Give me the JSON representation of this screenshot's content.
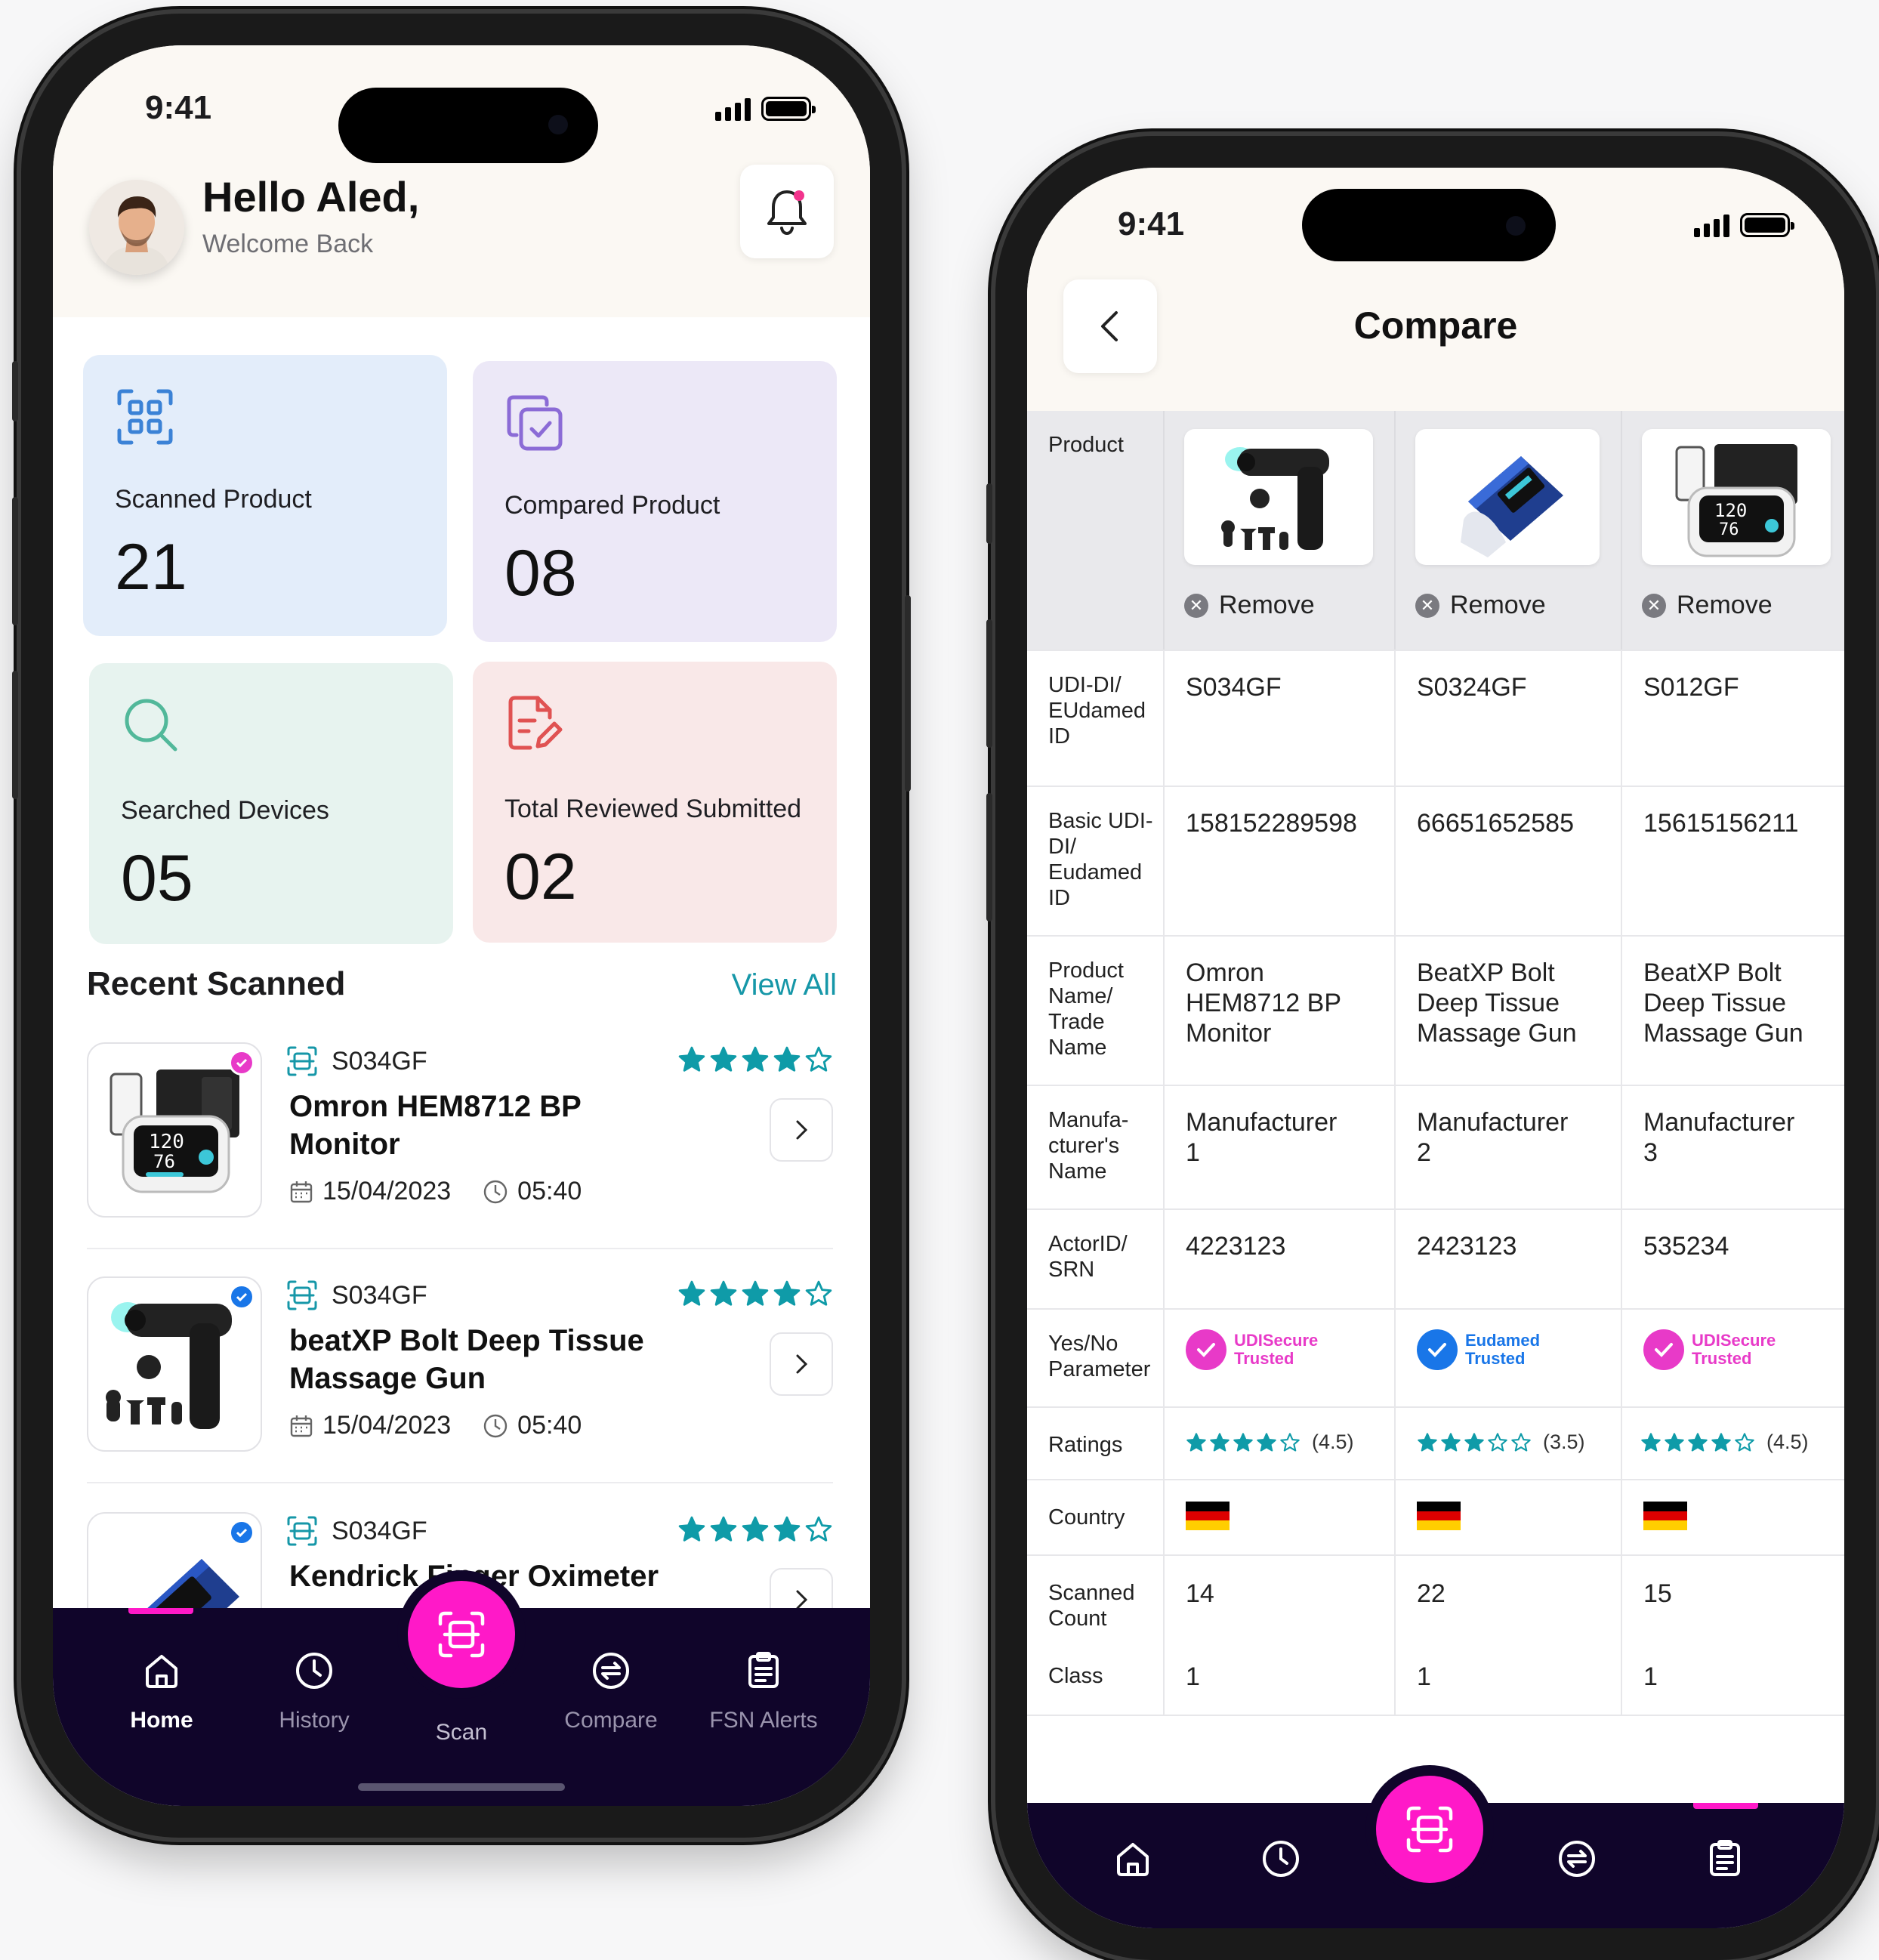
{
  "colors": {
    "accent": "#1697a8",
    "scan_button": "#ff19c8",
    "tab_bar": "#10052a",
    "star": "#0f9ba8",
    "card_scanned": "#e3edfa",
    "card_compared": "#ece8f7",
    "card_searched": "#e7f3ef",
    "card_reviewed": "#f9e8e8"
  },
  "home": {
    "status_time": "9:41",
    "greeting": "Hello Aled,",
    "subtitle": "Welcome Back",
    "stats": [
      {
        "label": "Scanned Product",
        "value": "21",
        "icon": "scan-grid-icon"
      },
      {
        "label": "Compared Product",
        "value": "08",
        "icon": "compare-copy-icon"
      },
      {
        "label": "Searched Devices",
        "value": "05",
        "icon": "search-icon"
      },
      {
        "label": "Total Reviewed Submitted",
        "value": "02",
        "icon": "review-document-icon"
      }
    ],
    "recent_title": "Recent Scanned",
    "view_all": "View All",
    "recent": [
      {
        "code": "S034GF",
        "name": "Omron HEM8712 BP Monitor",
        "date": "15/04/2023",
        "time": "05:40",
        "rating": 4,
        "badge": "udisecure"
      },
      {
        "code": "S034GF",
        "name": "beatXP Bolt Deep Tissue Massage Gun",
        "date": "15/04/2023",
        "time": "05:40",
        "rating": 4,
        "badge": "eudamed"
      },
      {
        "code": "S034GF",
        "name": "Kendrick Finger Oximeter",
        "date": "",
        "time": "",
        "rating": 4,
        "badge": "eudamed"
      }
    ],
    "tabs": [
      {
        "label": "Home",
        "icon": "home-icon"
      },
      {
        "label": "History",
        "icon": "clock-icon"
      },
      {
        "label": "Scan",
        "icon": "scan-icon"
      },
      {
        "label": "Compare",
        "icon": "compare-icon"
      },
      {
        "label": "FSN Alerts",
        "icon": "clipboard-icon"
      }
    ]
  },
  "compare": {
    "status_time": "9:41",
    "title": "Compare",
    "remove_label": "Remove",
    "rows": [
      {
        "label": "Product"
      },
      {
        "label": "UDI-DI/ EUdamed ID",
        "values": [
          "S034GF",
          "S0324GF",
          "S012GF"
        ]
      },
      {
        "label": "Basic UDI-DI/ Eudamed ID",
        "values": [
          "158152289598",
          "66651652585",
          "15615156211"
        ]
      },
      {
        "label": "Product Name/ Trade Name",
        "values": [
          "Omron HEM8712 BP Monitor",
          "BeatXP Bolt Deep Tissue Massage Gun",
          "BeatXP Bolt Deep Tissue Massage Gun"
        ]
      },
      {
        "label": "Manufa-cturer's Name",
        "values": [
          "Manufacturer 1",
          "Manufacturer 2",
          "Manufacturer 3"
        ]
      },
      {
        "label": "ActorID/ SRN",
        "values": [
          "4223123",
          "2423123",
          "535234"
        ]
      },
      {
        "label": "Yes/No Parameter",
        "values": [
          "UDISecure Trusted",
          "Eudamed Trusted",
          "UDISecure Trusted"
        ]
      },
      {
        "label": "Ratings",
        "values": [
          "(4.5)",
          "(3.5)",
          "(4.5)"
        ],
        "stars": [
          4,
          3,
          4
        ]
      },
      {
        "label": "Country",
        "values": [
          "Germany",
          "Germany",
          "Germany"
        ]
      },
      {
        "label": "Scanned Count",
        "values": [
          "14",
          "22",
          "15"
        ]
      },
      {
        "label": "Class",
        "values": [
          "1",
          "1",
          "1"
        ]
      }
    ],
    "badges": [
      {
        "line1": "UDISecure",
        "line2": "Trusted",
        "color": "#e83ac8"
      },
      {
        "line1": "Eudamed",
        "line2": "Trusted",
        "color": "#1976e8"
      },
      {
        "line1": "UDISecure",
        "line2": "Trusted",
        "color": "#e83ac8"
      }
    ]
  }
}
